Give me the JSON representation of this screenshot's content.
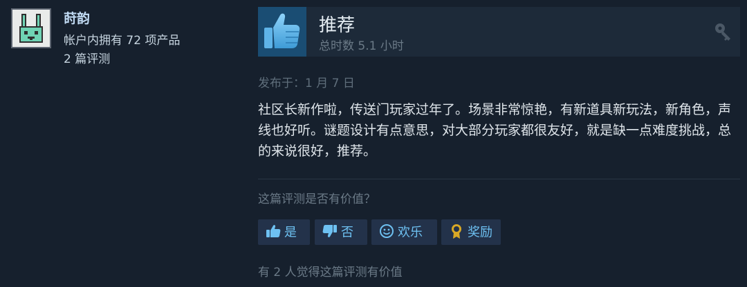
{
  "author": {
    "name": "莳韵",
    "products_owned": "帐户内拥有 72 项产品",
    "review_count": "2 篇评测"
  },
  "review": {
    "verdict": "推荐",
    "hours": "总时数 5.1 小时",
    "posted": "发布于：1 月 7 日",
    "body": "社区长新作啦，传送门玩家过年了。场景非常惊艳，有新道具新玩法，新角色，声线也好听。谜题设计有点意思，对大部分玩家都很友好，就是缺一点难度挑战，总的来说很好，推荐。"
  },
  "helpful": {
    "question": "这篇评测是否有价值？",
    "buttons": {
      "yes": "是",
      "no": "否",
      "funny": "欢乐",
      "award": "奖励"
    },
    "found_helpful": "有 2 人觉得这篇评测有价值"
  },
  "icons": {
    "avatar": "rabbit-pixel-avatar",
    "verdict": "thumbs-up-icon",
    "product_key": "key-icon",
    "yes": "thumbs-up-icon",
    "no": "thumbs-down-icon",
    "funny": "smiley-icon",
    "award": "award-medal-icon"
  },
  "colors": {
    "background": "#16202d",
    "author_name": "#c1dbf4",
    "thumb_box": "#1a4d73",
    "thumb_icon": "#66c0f4",
    "vote_button_bg": "#23324a",
    "vote_button_text": "#6ec1f2",
    "award_gold": "#d9a825"
  }
}
